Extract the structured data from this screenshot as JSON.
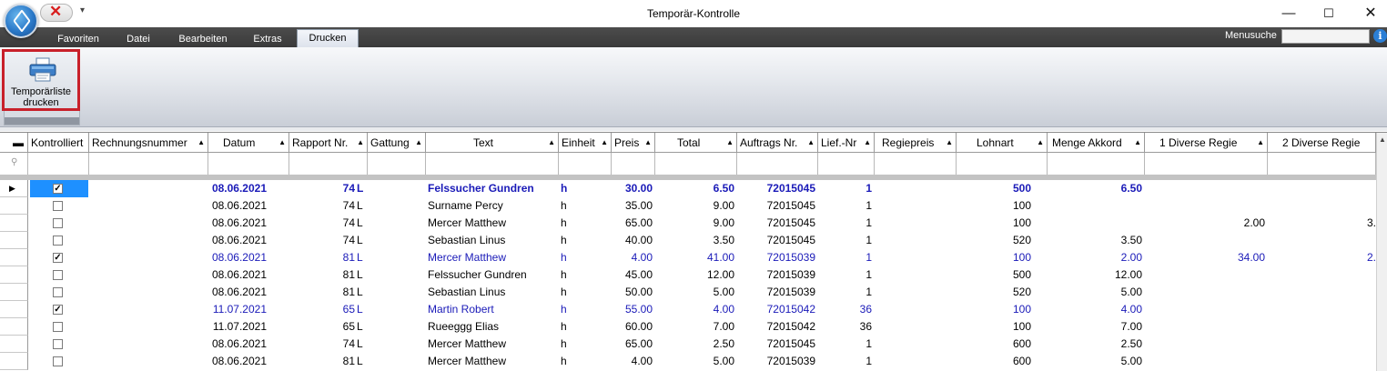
{
  "window": {
    "title": "Temporär-Kontrolle",
    "minimize": "—",
    "maximize": "☐",
    "close": "✕"
  },
  "quick_access": {
    "close_glyph": "✕",
    "dropdown_glyph": "▾"
  },
  "tabs": [
    {
      "label": "Favoriten",
      "active": false
    },
    {
      "label": "Datei",
      "active": false
    },
    {
      "label": "Bearbeiten",
      "active": false
    },
    {
      "label": "Extras",
      "active": false
    },
    {
      "label": "Drucken",
      "active": true
    }
  ],
  "menusearch": {
    "label": "Menusuche",
    "value": "",
    "info": "i"
  },
  "ribbon": {
    "print_button_label_line1": "Temporärliste",
    "print_button_label_line2": "drucken",
    "print_icon": "printer-icon",
    "highlight_color": "#c8202a"
  },
  "colors": {
    "accent_blue": "#1a1ab8",
    "selection": "#1e90ff"
  },
  "grid": {
    "columns": [
      {
        "label": "",
        "sort": ""
      },
      {
        "label": "Kontrolliert",
        "sort": ""
      },
      {
        "label": "Rechnungsnummer",
        "sort": "▲"
      },
      {
        "label": "Datum",
        "sort": "▲"
      },
      {
        "label": "Rapport Nr.",
        "sort": "▲"
      },
      {
        "label": "Gattung",
        "sort": "▲"
      },
      {
        "label": "Text",
        "sort": "▲"
      },
      {
        "label": "Einheit",
        "sort": "▲"
      },
      {
        "label": "Preis",
        "sort": "▲"
      },
      {
        "label": "Total",
        "sort": "▲"
      },
      {
        "label": "Auftrags Nr.",
        "sort": "▲"
      },
      {
        "label": "Lief.-Nr",
        "sort": "▲"
      },
      {
        "label": "Regiepreis",
        "sort": "▲"
      },
      {
        "label": "Lohnart",
        "sort": "▲"
      },
      {
        "label": "Menge Akkord",
        "sort": "▲"
      },
      {
        "label": "1 Diverse Regie",
        "sort": "▲"
      },
      {
        "label": "2 Diverse Regie",
        "sort": ""
      }
    ],
    "header_corner": "▬",
    "filter_icon": "filter-icon",
    "current_row_marker": "▶",
    "rows": [
      {
        "checked": true,
        "style": "blue-bold",
        "datum": "08.06.2021",
        "rapport": "74",
        "gattung": "L",
        "text": "Felssucher Gundren",
        "einheit": "h",
        "preis": "30.00",
        "total": "6.50",
        "auftrag": "72015045",
        "lief": "1",
        "regiepreis": "",
        "lohnart": "500",
        "menge": "6.50",
        "div1": "",
        "div2": ""
      },
      {
        "checked": false,
        "style": "normal",
        "datum": "08.06.2021",
        "rapport": "74",
        "gattung": "L",
        "text": "Surname Percy",
        "einheit": "h",
        "preis": "35.00",
        "total": "9.00",
        "auftrag": "72015045",
        "lief": "1",
        "regiepreis": "",
        "lohnart": "100",
        "menge": "",
        "div1": "",
        "div2": ""
      },
      {
        "checked": false,
        "style": "normal",
        "datum": "08.06.2021",
        "rapport": "74",
        "gattung": "L",
        "text": "Mercer Matthew",
        "einheit": "h",
        "preis": "65.00",
        "total": "9.00",
        "auftrag": "72015045",
        "lief": "1",
        "regiepreis": "",
        "lohnart": "100",
        "menge": "",
        "div1": "2.00",
        "div2": "3."
      },
      {
        "checked": false,
        "style": "normal",
        "datum": "08.06.2021",
        "rapport": "74",
        "gattung": "L",
        "text": "Sebastian Linus",
        "einheit": "h",
        "preis": "40.00",
        "total": "3.50",
        "auftrag": "72015045",
        "lief": "1",
        "regiepreis": "",
        "lohnart": "520",
        "menge": "3.50",
        "div1": "",
        "div2": ""
      },
      {
        "checked": true,
        "style": "blue",
        "datum": "08.06.2021",
        "rapport": "81",
        "gattung": "L",
        "text": "Mercer Matthew",
        "einheit": "h",
        "preis": "4.00",
        "total": "41.00",
        "auftrag": "72015039",
        "lief": "1",
        "regiepreis": "",
        "lohnart": "100",
        "menge": "2.00",
        "div1": "34.00",
        "div2": "2."
      },
      {
        "checked": false,
        "style": "normal",
        "datum": "08.06.2021",
        "rapport": "81",
        "gattung": "L",
        "text": "Felssucher Gundren",
        "einheit": "h",
        "preis": "45.00",
        "total": "12.00",
        "auftrag": "72015039",
        "lief": "1",
        "regiepreis": "",
        "lohnart": "500",
        "menge": "12.00",
        "div1": "",
        "div2": ""
      },
      {
        "checked": false,
        "style": "normal",
        "datum": "08.06.2021",
        "rapport": "81",
        "gattung": "L",
        "text": "Sebastian Linus",
        "einheit": "h",
        "preis": "50.00",
        "total": "5.00",
        "auftrag": "72015039",
        "lief": "1",
        "regiepreis": "",
        "lohnart": "520",
        "menge": "5.00",
        "div1": "",
        "div2": ""
      },
      {
        "checked": true,
        "style": "blue",
        "datum": "11.07.2021",
        "rapport": "65",
        "gattung": "L",
        "text": "Martin Robert",
        "einheit": "h",
        "preis": "55.00",
        "total": "4.00",
        "auftrag": "72015042",
        "lief": "36",
        "regiepreis": "",
        "lohnart": "100",
        "menge": "4.00",
        "div1": "",
        "div2": ""
      },
      {
        "checked": false,
        "style": "normal",
        "datum": "11.07.2021",
        "rapport": "65",
        "gattung": "L",
        "text": "Rueeggg Elias",
        "einheit": "h",
        "preis": "60.00",
        "total": "7.00",
        "auftrag": "72015042",
        "lief": "36",
        "regiepreis": "",
        "lohnart": "100",
        "menge": "7.00",
        "div1": "",
        "div2": ""
      },
      {
        "checked": false,
        "style": "normal",
        "datum": "08.06.2021",
        "rapport": "74",
        "gattung": "L",
        "text": "Mercer Matthew",
        "einheit": "h",
        "preis": "65.00",
        "total": "2.50",
        "auftrag": "72015045",
        "lief": "1",
        "regiepreis": "",
        "lohnart": "600",
        "menge": "2.50",
        "div1": "",
        "div2": ""
      },
      {
        "checked": false,
        "style": "normal",
        "datum": "08.06.2021",
        "rapport": "81",
        "gattung": "L",
        "text": "Mercer Matthew",
        "einheit": "h",
        "preis": "4.00",
        "total": "5.00",
        "auftrag": "72015039",
        "lief": "1",
        "regiepreis": "",
        "lohnart": "600",
        "menge": "5.00",
        "div1": "",
        "div2": ""
      }
    ]
  }
}
